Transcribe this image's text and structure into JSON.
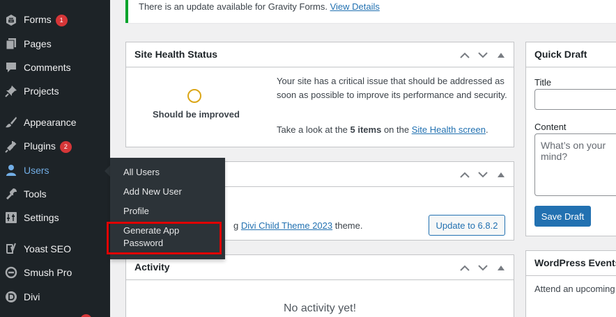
{
  "sidebar": {
    "items": [
      {
        "label": "Forms",
        "icon": "gravity-forms-icon",
        "badge": "1"
      },
      {
        "label": "Pages",
        "icon": "pages-icon"
      },
      {
        "label": "Comments",
        "icon": "comments-icon"
      },
      {
        "label": "Projects",
        "icon": "pin-icon"
      },
      {
        "label": "Appearance",
        "icon": "paintbrush-icon"
      },
      {
        "label": "Plugins",
        "icon": "plugins-icon",
        "badge": "2"
      },
      {
        "label": "Users",
        "icon": "users-icon"
      },
      {
        "label": "Tools",
        "icon": "tools-icon"
      },
      {
        "label": "Settings",
        "icon": "settings-icon"
      },
      {
        "label": "Yoast SEO",
        "icon": "yoast-icon"
      },
      {
        "label": "Smush Pro",
        "icon": "smush-icon"
      },
      {
        "label": "Divi",
        "icon": "divi-icon"
      }
    ]
  },
  "flyout": {
    "items": [
      "All Users",
      "Add New User",
      "Profile",
      "Generate App\nPassword"
    ]
  },
  "notice": {
    "text": "There is an update available for Gravity Forms. ",
    "link": "View Details"
  },
  "site_health": {
    "title": "Site Health Status",
    "status": "Should be improved",
    "description": "Your site has a critical issue that should be addressed as soon as possible to improve its performance and security.",
    "items_prefix": "Take a look at the ",
    "items_count": "5 items",
    "items_middle": " on the ",
    "items_link": "Site Health screen",
    "items_suffix": "."
  },
  "at_a_glance": {
    "text_prefix": "g ",
    "theme_link": "Divi Child Theme 2023",
    "text_suffix": " theme.",
    "update_button": "Update to 6.8.2"
  },
  "activity": {
    "title": "Activity",
    "empty": "No activity yet!"
  },
  "quick_draft": {
    "title": "Quick Draft",
    "title_label": "Title",
    "content_label": "Content",
    "content_placeholder": "What’s on your mind?",
    "save_button": "Save Draft"
  },
  "events": {
    "title": "WordPress Events",
    "text": "Attend an upcoming"
  },
  "colors": {
    "sidebar_bg": "#1d2327",
    "accent": "#2271b1",
    "badge": "#d63638",
    "highlight": "#e00000",
    "health_warning": "#dba617",
    "notice_success": "#00a32a"
  }
}
